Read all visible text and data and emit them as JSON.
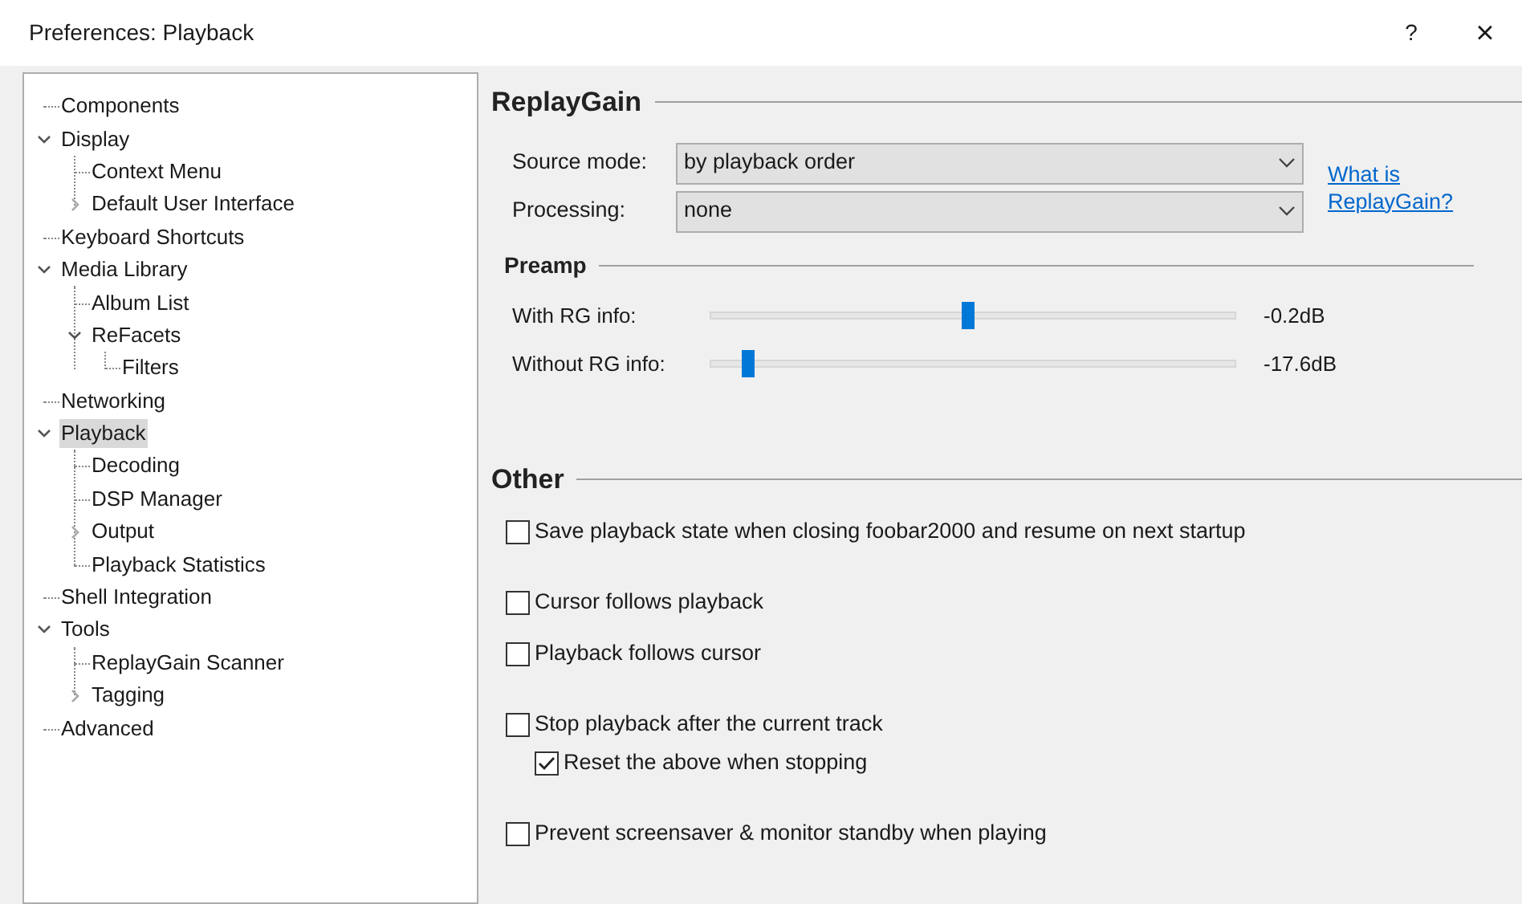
{
  "window": {
    "title": "Preferences: Playback",
    "help": "?",
    "close": "×"
  },
  "tree": [
    {
      "label": "Components",
      "selected": false
    },
    {
      "label": "Display",
      "selected": false,
      "expanded": true,
      "children": [
        {
          "label": "Context Menu",
          "selected": false
        },
        {
          "label": "Default User Interface",
          "selected": false,
          "expanded": false
        }
      ]
    },
    {
      "label": "Keyboard Shortcuts",
      "selected": false
    },
    {
      "label": "Media Library",
      "selected": false,
      "expanded": true,
      "children": [
        {
          "label": "Album List",
          "selected": false
        },
        {
          "label": "ReFacets",
          "selected": false,
          "expanded": true,
          "children": [
            {
              "label": "Filters",
              "selected": false
            }
          ]
        }
      ]
    },
    {
      "label": "Networking",
      "selected": false
    },
    {
      "label": "Playback",
      "selected": true,
      "expanded": true,
      "children": [
        {
          "label": "Decoding",
          "selected": false
        },
        {
          "label": "DSP Manager",
          "selected": false
        },
        {
          "label": "Output",
          "selected": false,
          "expanded": false
        },
        {
          "label": "Playback Statistics",
          "selected": false
        }
      ]
    },
    {
      "label": "Shell Integration",
      "selected": false
    },
    {
      "label": "Tools",
      "selected": false,
      "expanded": true,
      "children": [
        {
          "label": "ReplayGain Scanner",
          "selected": false
        },
        {
          "label": "Tagging",
          "selected": false,
          "expanded": false
        }
      ]
    },
    {
      "label": "Advanced",
      "selected": false
    }
  ],
  "replaygain": {
    "title": "ReplayGain",
    "fields": [
      {
        "label": "Source mode:",
        "value": "by playback order"
      },
      {
        "label": "Processing:",
        "value": "none"
      }
    ],
    "link": "What is ReplayGain?",
    "preamp": {
      "title": "Preamp",
      "sliders": [
        {
          "label": "With RG info:",
          "level": 0.49,
          "reading": "-0.2dB"
        },
        {
          "label": "Without RG info:",
          "level": 0.07,
          "reading": "-17.6dB"
        }
      ]
    }
  },
  "other": {
    "title": "Other",
    "groups": [
      {
        "options": [
          {
            "label": "Save playback state when closing foobar2000 and resume on next startup",
            "checked": false
          }
        ]
      },
      {
        "options": [
          {
            "label": "Cursor follows playback",
            "checked": false
          },
          {
            "label": "Playback follows cursor",
            "checked": false
          }
        ]
      },
      {
        "options": [
          {
            "label": "Stop playback after the current track",
            "checked": false,
            "children": [
              {
                "label": "Reset the above when stopping",
                "checked": true
              }
            ]
          }
        ]
      },
      {
        "options": [
          {
            "label": "Prevent screensaver & monitor standby when playing",
            "checked": false
          }
        ]
      }
    ]
  }
}
